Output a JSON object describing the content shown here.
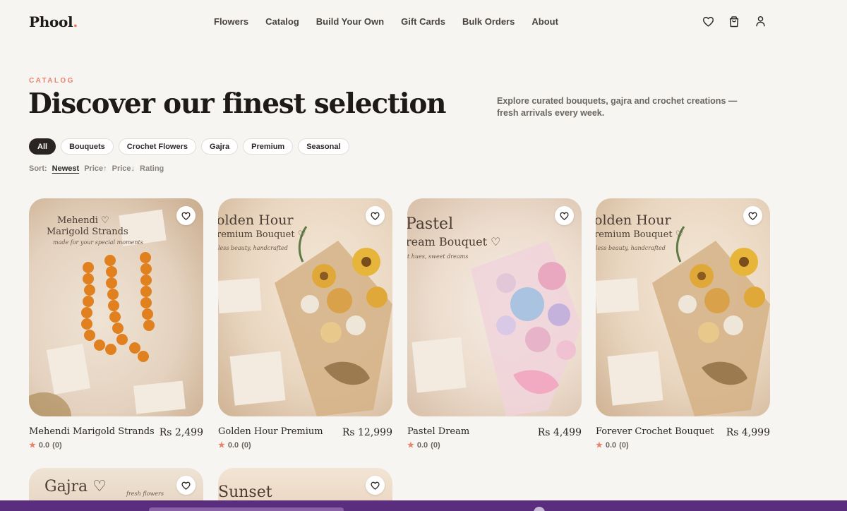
{
  "brand": {
    "name": "Phool",
    "dot": ".",
    "accent": "#e8705c"
  },
  "nav": {
    "items": [
      "Flowers",
      "Catalog",
      "Build Your Own",
      "Gift Cards",
      "Bulk Orders",
      "About"
    ]
  },
  "header_icons": [
    "heart-icon",
    "cart-icon",
    "user-icon"
  ],
  "hero": {
    "eyebrow": "CATALOG",
    "title": "Discover our finest selection",
    "subtitle": "Explore curated bouquets, gajra and crochet creations — fresh arrivals every week."
  },
  "filters": {
    "items": [
      "All",
      "Bouquets",
      "Crochet Flowers",
      "Gajra",
      "Premium",
      "Seasonal"
    ],
    "active": "All"
  },
  "sort": {
    "label": "Sort:",
    "options": [
      "Newest",
      "Price↑",
      "Price↓",
      "Rating"
    ],
    "active": "Newest"
  },
  "products": [
    {
      "name": "Mehendi Marigold Strands",
      "price": "Rs 2,499",
      "rating": "0.0",
      "reviews": "(0)",
      "image_title": "Mehendi ♡",
      "image_title2": "Marigold Strands",
      "image_sub": "made for your special moments"
    },
    {
      "name": "Golden Hour Premium",
      "price": "Rs 12,999",
      "rating": "0.0",
      "reviews": "(0)",
      "image_title": "olden Hour",
      "image_title2": "remium Bouquet ♡",
      "image_sub": "less beauty, handcrafted"
    },
    {
      "name": "Pastel Dream",
      "price": "Rs 4,499",
      "rating": "0.0",
      "reviews": "(0)",
      "image_title": "Pastel",
      "image_title2": "ream Bouquet ♡",
      "image_sub": "t hues, sweet dreams"
    },
    {
      "name": "Forever Crochet Bouquet",
      "price": "Rs 4,999",
      "rating": "0.0",
      "reviews": "(0)",
      "image_title": "olden Hour",
      "image_title2": "remium Bouquet ♡",
      "image_sub": "less beauty, handcrafted"
    },
    {
      "image_title": "Gajra ♡",
      "image_sub": "fresh flowers"
    },
    {
      "image_title": "Sunset"
    }
  ],
  "colors": {
    "background": "#f7f5f1",
    "text_dark": "#2a2522",
    "accent_coral": "#e8836e",
    "bottom_bar": "#5b2d7f"
  }
}
